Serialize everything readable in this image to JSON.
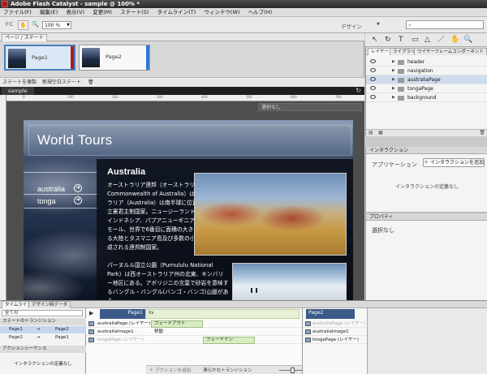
{
  "window": {
    "title": "Adobe Flash Catalyst - sample @ 100% *"
  },
  "menu": [
    "ファイル(F)",
    "編集(E)",
    "表示(V)",
    "変更(M)",
    "ステート(S)",
    "タイムライン(T)",
    "ウィンドウ(W)",
    "ヘルプ(H)"
  ],
  "toolbar": {
    "logo": "FC",
    "hand": "✋",
    "zoom_icon": "🔍",
    "zoom_value": "100 %",
    "workspace": "デザイン",
    "search_icon": "⌕"
  },
  "pages": {
    "panel_title": "ページ / ステート",
    "states": [
      {
        "label": "Page1",
        "edge_color": "#b21b1b"
      },
      {
        "label": "Page2",
        "edge_color": "#2b7ad6"
      }
    ],
    "duplicate_state": "ステートを複製",
    "new_blank_state": "新規空白ステート"
  },
  "document": {
    "tab": "sample",
    "selection": "選択なし"
  },
  "artboard": {
    "title": "World Tours",
    "nav": [
      {
        "label": "australia"
      },
      {
        "label": "tonga"
      }
    ],
    "heading": "Australia",
    "paragraph1": "オーストラリア連邦（オーストラリア、英語: Commonwealth of Australia）はオーストラリア（Australia）は南半球に位置する連邦立憲君主制国家。ニュージーランド、北にはインドネシア、パプアニューギニア、東ティモール、世界で6番目に面積の大きい国である大陸とタスマニア島及び多数の小島から構成される連邦制国家。",
    "paragraph2": "パーヌルル国立公園（Purnululu National Park）は西オーストラリア州の北東、キンバリー地区にある。アボリジニの言葉で砂岩を意味するバングル・バングル(バンゴ・バンゴ)山脈がある。"
  },
  "tools": [
    "↖",
    "↻",
    "T",
    "▭",
    "△",
    "／",
    "✋",
    "🔍"
  ],
  "layers": {
    "tabs": [
      "レイヤー",
      "ライブラリ",
      "ワイヤーフレームコンポーネント"
    ],
    "items": [
      {
        "name": "header",
        "selected": false
      },
      {
        "name": "navigation",
        "selected": false
      },
      {
        "name": "australiaPage",
        "selected": true
      },
      {
        "name": "tongaPage",
        "selected": false
      },
      {
        "name": "background",
        "selected": false
      }
    ]
  },
  "interactions": {
    "title": "インタラクション",
    "app_label": "アプリケーション",
    "add_button": "＋ インタラクションを追加",
    "empty_text": "インタラクションの定義なし"
  },
  "properties": {
    "title": "プロパティ",
    "empty_text": "選択なし"
  },
  "timeline": {
    "tabs": [
      "タイムライン",
      "デザイン時データ"
    ],
    "filter": "全ての",
    "transitions_header": "ステートのトランジション",
    "transitions": [
      {
        "from": "Page1",
        "to": "Page2",
        "selected": true
      },
      {
        "from": "Page2",
        "to": "Page1",
        "selected": false
      }
    ],
    "action_header": "アクションシーケンス",
    "action_empty": "インタラクションの定義なし",
    "from_state": "Page1",
    "to_state": "Page2",
    "ruler_zero": "0s",
    "objects": [
      {
        "name": "australiaPage (レイヤー)",
        "dim": false
      },
      {
        "name": "australiaImage1",
        "dim": false
      },
      {
        "name": "tongaPage (レイヤー)",
        "dim": true
      }
    ],
    "effects": {
      "fade_out": "フェードアウト",
      "move": "移動",
      "fade_in": "フェードイン"
    },
    "right_objects": [
      {
        "name": "australiaPage (レイヤー)",
        "dim": true
      },
      {
        "name": "australiaImage1",
        "dim": false
      },
      {
        "name": "tongaPage (レイヤー)",
        "dim": false
      }
    ],
    "add_action": "＋ アクションを追加",
    "smooth_transition": "滑らかなトランジション"
  }
}
